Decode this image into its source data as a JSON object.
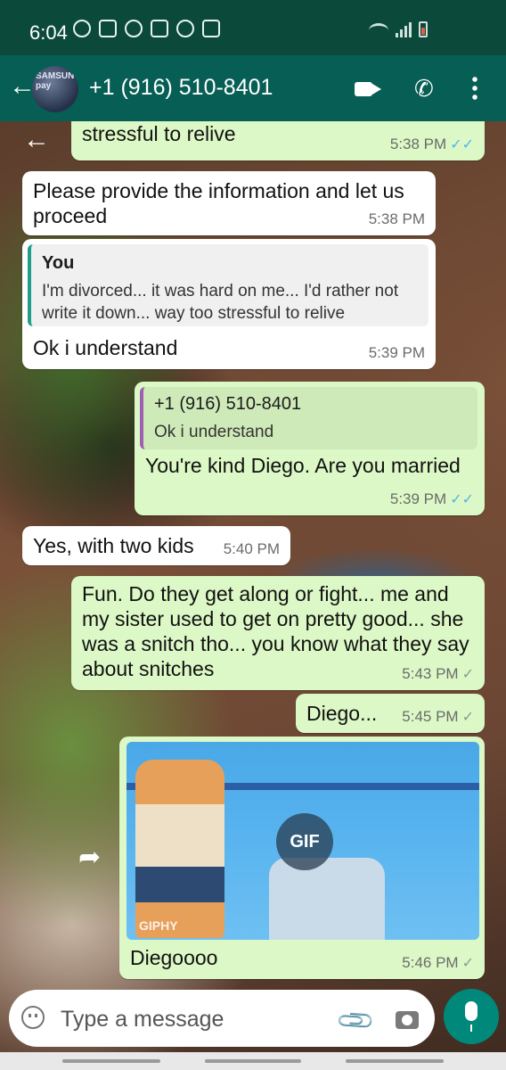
{
  "status_bar": {
    "time": "6:04"
  },
  "header": {
    "avatar_text": "SAMSUNG pay",
    "contact_name": "+1 (916) 510-8401"
  },
  "messages": [
    {
      "text": "stressful to relive",
      "time": "5:38 PM"
    },
    {
      "text": "Please provide the information and let us proceed",
      "time": "5:38 PM"
    },
    {
      "quote_name": "You",
      "quote_text": "I'm divorced... it was hard on me... I'd rather not write it down... way too stressful to relive",
      "text": "Ok i understand",
      "time": "5:39 PM"
    },
    {
      "quote_name": "+1 (916) 510-8401",
      "quote_text": "Ok i understand",
      "text": "You're kind Diego. Are you married",
      "time": "5:39 PM"
    },
    {
      "text": "Yes, with two kids",
      "time": "5:40 PM"
    },
    {
      "text": "Fun.  Do they get along or fight... me and my sister used to get on pretty good... she was a snitch tho... you know what they say about snitches",
      "time": "5:43 PM"
    },
    {
      "text": "Diego...",
      "time": "5:45 PM"
    },
    {
      "gif_badge": "GIF",
      "gif_watermark": "GIPHY",
      "text": "Diegoooo",
      "time": "5:46 PM"
    }
  ],
  "input": {
    "placeholder": "Type a message"
  }
}
